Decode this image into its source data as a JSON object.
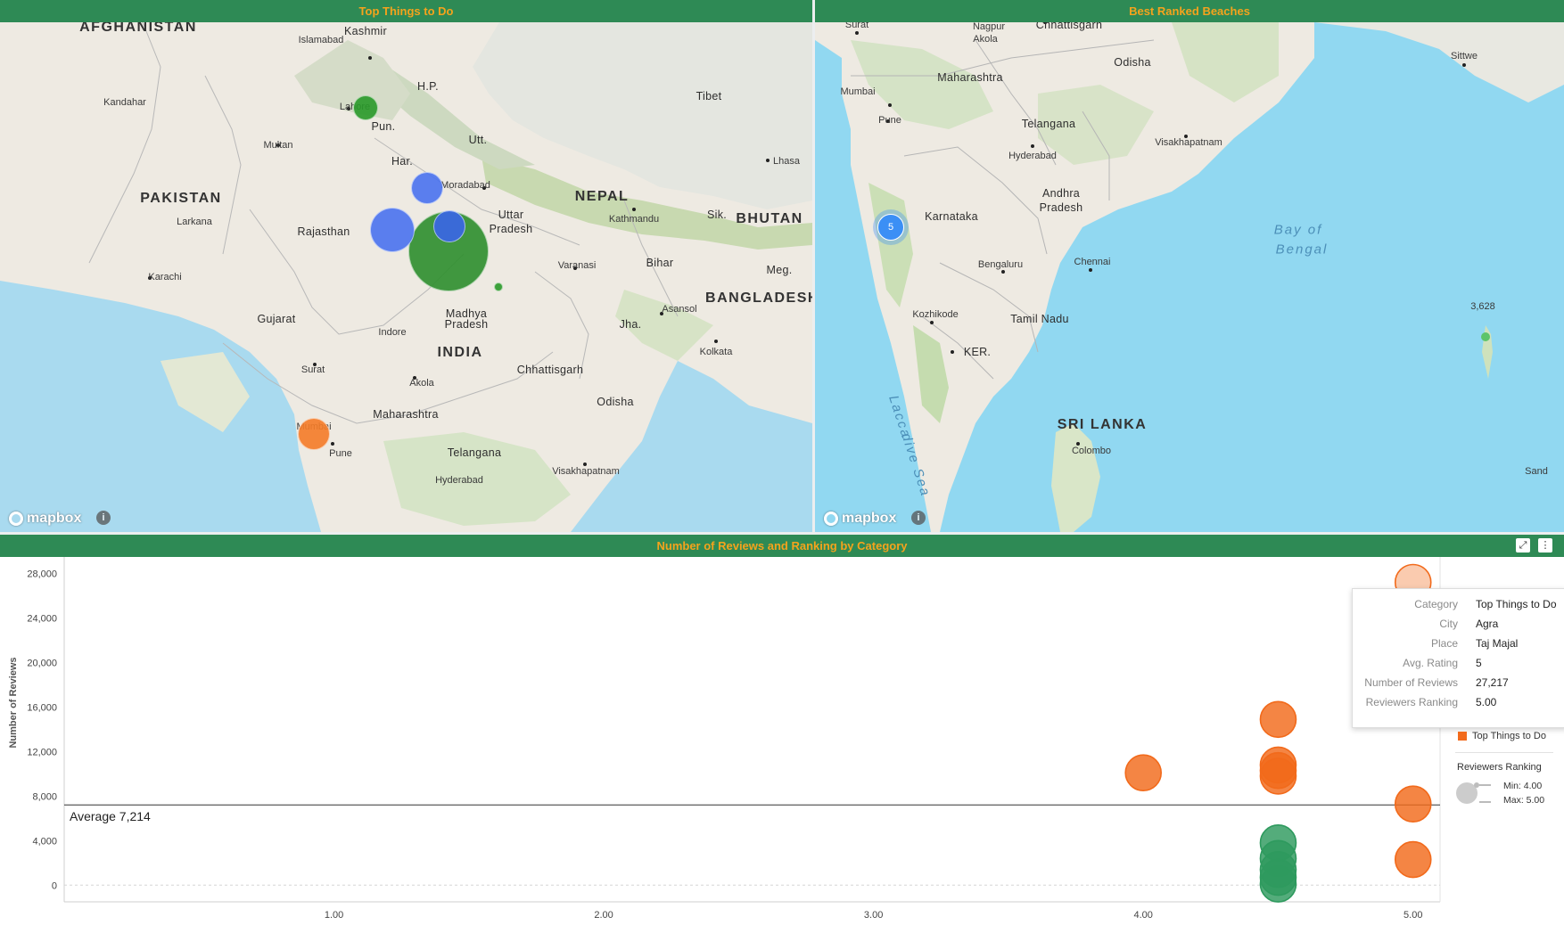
{
  "panels": {
    "top_things": {
      "title": "Top Things to Do",
      "labels": [
        {
          "text": "AFGHANISTAN",
          "kind": "country"
        },
        {
          "text": "Islamabad",
          "kind": "city"
        },
        {
          "text": "Kashmir",
          "kind": "state"
        },
        {
          "text": "Kandahar",
          "kind": "city"
        },
        {
          "text": "Lahore",
          "kind": "city"
        },
        {
          "text": "H.P.",
          "kind": "state"
        },
        {
          "text": "Tibet",
          "kind": "state"
        },
        {
          "text": "Pun.",
          "kind": "state"
        },
        {
          "text": "Multan",
          "kind": "city"
        },
        {
          "text": "Utt.",
          "kind": "state"
        },
        {
          "text": "Lhasa",
          "kind": "city"
        },
        {
          "text": "Har.",
          "kind": "state"
        },
        {
          "text": "PAKISTAN",
          "kind": "country"
        },
        {
          "text": "Moradabad",
          "kind": "city"
        },
        {
          "text": "NEPAL",
          "kind": "country"
        },
        {
          "text": "Larkana",
          "kind": "city"
        },
        {
          "text": "Rajasthan",
          "kind": "state"
        },
        {
          "text": "Uttar",
          "kind": "state"
        },
        {
          "text": "Pradesh",
          "kind": "state"
        },
        {
          "text": "Kathmandu",
          "kind": "city"
        },
        {
          "text": "Sik.",
          "kind": "state"
        },
        {
          "text": "BHUTAN",
          "kind": "country"
        },
        {
          "text": "Karachi",
          "kind": "city"
        },
        {
          "text": "Varanasi",
          "kind": "city"
        },
        {
          "text": "Bihar",
          "kind": "state"
        },
        {
          "text": "Meg.",
          "kind": "state"
        },
        {
          "text": "BANGLADESH",
          "kind": "country"
        },
        {
          "text": "Gujarat",
          "kind": "state"
        },
        {
          "text": "Madhya",
          "kind": "state"
        },
        {
          "text": "Pradesh",
          "kind": "state"
        },
        {
          "text": "Asansol",
          "kind": "city"
        },
        {
          "text": "Indore",
          "kind": "city"
        },
        {
          "text": "Jha.",
          "kind": "state"
        },
        {
          "text": "INDIA",
          "kind": "country"
        },
        {
          "text": "Kolkata",
          "kind": "city"
        },
        {
          "text": "Chhattisgarh",
          "kind": "state"
        },
        {
          "text": "Surat",
          "kind": "city"
        },
        {
          "text": "Akola",
          "kind": "city"
        },
        {
          "text": "Odisha",
          "kind": "state"
        },
        {
          "text": "Maharashtra",
          "kind": "state"
        },
        {
          "text": "Mumbai",
          "kind": "city"
        },
        {
          "text": "Pune",
          "kind": "city"
        },
        {
          "text": "Telangana",
          "kind": "state"
        },
        {
          "text": "Hyderabad",
          "kind": "city"
        },
        {
          "text": "Visakhapatnam",
          "kind": "city"
        }
      ],
      "bubbles": [
        {
          "color": "#2a9a2a"
        },
        {
          "color": "#2e8f2e"
        },
        {
          "color": "#4a73f0"
        },
        {
          "color": "#4a73f0"
        },
        {
          "color": "#3a66e8"
        },
        {
          "color": "#2a9a2a"
        },
        {
          "color": "#f57c28"
        }
      ]
    },
    "beaches": {
      "title": "Best Ranked Beaches",
      "labels": [
        {
          "text": "Surat",
          "kind": "city"
        },
        {
          "text": "Nagpur",
          "kind": "city"
        },
        {
          "text": "Chhattisgarh",
          "kind": "state"
        },
        {
          "text": "Akola",
          "kind": "city"
        },
        {
          "text": "Odisha",
          "kind": "state"
        },
        {
          "text": "Sittwe",
          "kind": "city"
        },
        {
          "text": "Maharashtra",
          "kind": "state"
        },
        {
          "text": "Mumbai",
          "kind": "city"
        },
        {
          "text": "Pune",
          "kind": "city"
        },
        {
          "text": "Telangana",
          "kind": "state"
        },
        {
          "text": "Visakhapatnam",
          "kind": "city"
        },
        {
          "text": "Hyderabad",
          "kind": "city"
        },
        {
          "text": "Andhra",
          "kind": "state"
        },
        {
          "text": "Pradesh",
          "kind": "state"
        },
        {
          "text": "Karnataka",
          "kind": "state"
        },
        {
          "text": "Bay of",
          "kind": "sea"
        },
        {
          "text": "Bengal",
          "kind": "sea"
        },
        {
          "text": "Bengaluru",
          "kind": "city"
        },
        {
          "text": "Chennai",
          "kind": "city"
        },
        {
          "text": "Kozhikode",
          "kind": "city"
        },
        {
          "text": "Tamil Nadu",
          "kind": "state"
        },
        {
          "text": "KER.",
          "kind": "state"
        },
        {
          "text": "Lacca",
          "kind": "sea"
        },
        {
          "text": "dive Sea",
          "kind": "sea"
        },
        {
          "text": "SRI LANKA",
          "kind": "country"
        },
        {
          "text": "Colombo",
          "kind": "city"
        },
        {
          "text": "3,628",
          "kind": "city"
        },
        {
          "text": "Sand",
          "kind": "city"
        }
      ],
      "cluster": {
        "count": "5",
        "color": "#3b8ff5"
      },
      "island_point": {
        "color": "#5cc46a"
      }
    },
    "chart": {
      "title": "Number of Reviews and Ranking by Category"
    }
  },
  "map_attribution": {
    "logo_text": "mapbox",
    "info_icon": "i"
  },
  "chart_data": {
    "type": "scatter",
    "title": "Number of Reviews and Ranking by Category",
    "xlabel": "Avg. Rating",
    "ylabel": "Number of Reviews",
    "xlim": [
      0,
      5.1
    ],
    "ylim": [
      -1500,
      29500
    ],
    "x_ticks": [
      "1.00",
      "2.00",
      "3.00",
      "4.00",
      "5.00"
    ],
    "y_ticks": [
      "0",
      "4,000",
      "8,000",
      "12,000",
      "16,000",
      "20,000",
      "24,000",
      "28,000"
    ],
    "reference_line": {
      "label": "Average 7,214",
      "value": 7214
    },
    "series": [
      {
        "name": "Top Things to Do",
        "color": "#f26a1b",
        "points": [
          {
            "x": 5,
            "y": 27217,
            "highlight": true
          },
          {
            "x": 4.5,
            "y": 14900
          },
          {
            "x": 4.5,
            "y": 10800
          },
          {
            "x": 4.5,
            "y": 10300
          },
          {
            "x": 4.5,
            "y": 9800
          },
          {
            "x": 4,
            "y": 10100
          },
          {
            "x": 5,
            "y": 7300
          },
          {
            "x": 5,
            "y": 2300
          }
        ]
      },
      {
        "name": "",
        "color": "#2e9a5e",
        "points": [
          {
            "x": 4.5,
            "y": 3800
          },
          {
            "x": 4.5,
            "y": 2400
          },
          {
            "x": 4.5,
            "y": 1400
          },
          {
            "x": 4.5,
            "y": 700
          },
          {
            "x": 4.5,
            "y": 100
          }
        ]
      }
    ]
  },
  "tooltip": {
    "rows": [
      {
        "key": "Category",
        "value": "Top Things to Do"
      },
      {
        "key": "City",
        "value": "Agra"
      },
      {
        "key": "Place",
        "value": "Taj Majal"
      },
      {
        "key": "Avg. Rating",
        "value": "5"
      },
      {
        "key": "Number of Reviews",
        "value": "27,217"
      },
      {
        "key": "Reviewers Ranking",
        "value": "5.00"
      }
    ]
  },
  "legend": {
    "category_label": "Top Things to Do",
    "category_color": "#f26a1b",
    "size_title": "Reviewers Ranking",
    "min_label": "Min: 4.00",
    "max_label": "Max: 5.00"
  },
  "header_buttons": {
    "expand_icon": "⤢",
    "menu_icon": "⋮"
  }
}
